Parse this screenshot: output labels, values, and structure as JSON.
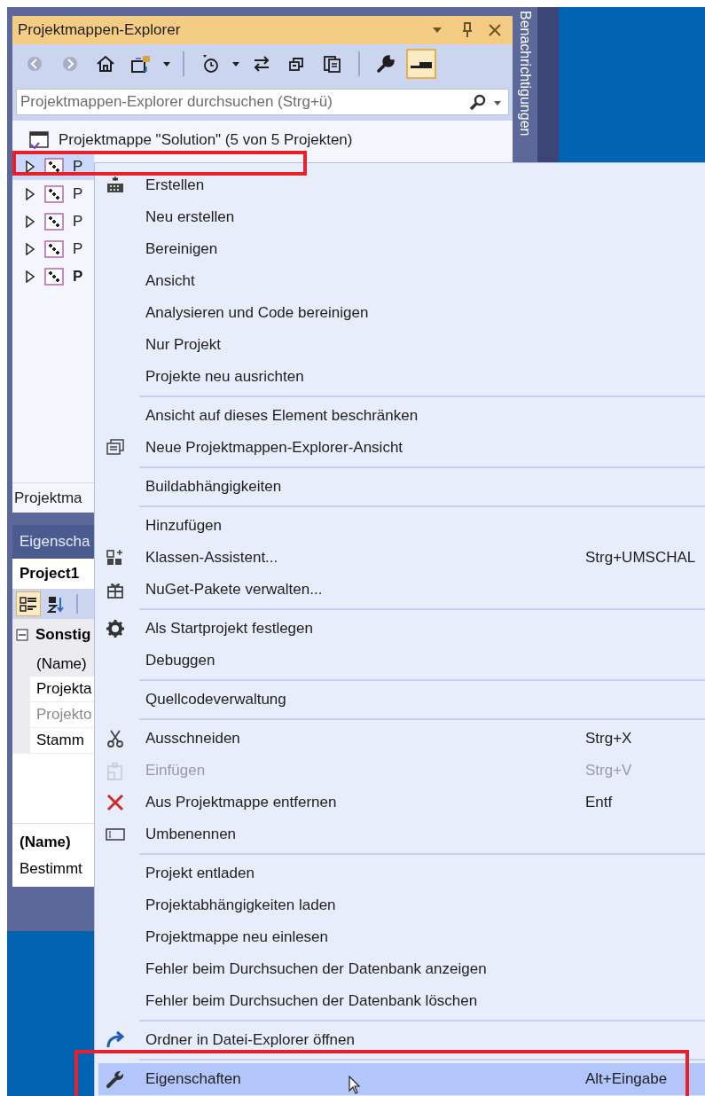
{
  "explorer": {
    "title": "Projektmappen-Explorer",
    "toolbar": [
      {
        "kind": "back",
        "disabled": true,
        "on": false
      },
      {
        "kind": "forward",
        "disabled": true,
        "on": false
      },
      {
        "kind": "home",
        "disabled": false,
        "on": false
      },
      {
        "kind": "switch-views",
        "disabled": false,
        "on": false
      },
      {
        "kind": "dropdown",
        "disabled": false,
        "on": false
      },
      {
        "kind": "separator"
      },
      {
        "kind": "pending",
        "disabled": false,
        "on": false
      },
      {
        "kind": "dropdown",
        "disabled": false,
        "on": false
      },
      {
        "kind": "sync",
        "disabled": false,
        "on": false
      },
      {
        "kind": "collapse",
        "disabled": false,
        "on": false
      },
      {
        "kind": "copy",
        "disabled": false,
        "on": false
      },
      {
        "kind": "separator"
      },
      {
        "kind": "properties",
        "disabled": false,
        "on": false
      },
      {
        "kind": "preview",
        "disabled": false,
        "on": true
      }
    ],
    "search": {
      "placeholder": "Projektmappen-Explorer durchsuchen (Strg+ü)"
    },
    "solution": "Projektmappe \"Solution\" (5 von 5 Projekten)",
    "projects": [
      {
        "label": "P",
        "selected": true,
        "startup": false
      },
      {
        "label": "P",
        "selected": false,
        "startup": false
      },
      {
        "label": "P",
        "selected": false,
        "startup": false
      },
      {
        "label": "P",
        "selected": false,
        "startup": false
      },
      {
        "label": "P",
        "selected": false,
        "startup": true
      }
    ],
    "bottom_tab": "Projektma"
  },
  "notifications_tab": "Benachrichtigungen",
  "properties": {
    "title": "Eigenscha",
    "object": "Project1",
    "toolbar": [
      {
        "kind": "categorized",
        "on": true
      },
      {
        "kind": "alphabetical",
        "on": false
      }
    ],
    "category": {
      "label": "Sonstig",
      "expanded": true
    },
    "rows": [
      {
        "label": "(Name)",
        "disabled": false,
        "selected": true
      },
      {
        "label": "Projekta",
        "disabled": false,
        "selected": false
      },
      {
        "label": "Projekto",
        "disabled": true,
        "selected": false
      },
      {
        "label": "Stamm",
        "disabled": false,
        "selected": false
      }
    ],
    "description": {
      "title": "(Name)",
      "text": "Bestimmt"
    }
  },
  "context_menu": {
    "items": [
      {
        "kind": "build",
        "label": "Erstellen",
        "disabled": false,
        "selected": false
      },
      {
        "kind": "plain",
        "label": "Neu erstellen",
        "disabled": false,
        "selected": false
      },
      {
        "kind": "plain",
        "label": "Bereinigen",
        "disabled": false,
        "selected": false
      },
      {
        "kind": "plain",
        "label": "Ansicht",
        "disabled": false,
        "selected": false
      },
      {
        "kind": "plain",
        "label": "Analysieren und Code bereinigen",
        "disabled": false,
        "selected": false
      },
      {
        "kind": "plain",
        "label": "Nur Projekt",
        "disabled": false,
        "selected": false
      },
      {
        "kind": "plain",
        "label": "Projekte neu ausrichten",
        "disabled": false,
        "selected": false
      },
      {
        "kind": "separator"
      },
      {
        "kind": "plain",
        "label": "Ansicht auf dieses Element beschränken",
        "disabled": false,
        "selected": false
      },
      {
        "kind": "window",
        "label": "Neue Projektmappen-Explorer-Ansicht",
        "disabled": false,
        "selected": false
      },
      {
        "kind": "separator"
      },
      {
        "kind": "plain",
        "label": "Buildabhängigkeiten",
        "disabled": false,
        "selected": false
      },
      {
        "kind": "separator"
      },
      {
        "kind": "plain",
        "label": "Hinzufügen",
        "disabled": false,
        "selected": false
      },
      {
        "kind": "wizard",
        "label": "Klassen-Assistent...",
        "shortcut": "Strg+UMSCHAL",
        "disabled": false,
        "selected": false
      },
      {
        "kind": "package",
        "label": "NuGet-Pakete verwalten...",
        "disabled": false,
        "selected": false
      },
      {
        "kind": "separator"
      },
      {
        "kind": "gear",
        "label": "Als Startprojekt festlegen",
        "disabled": false,
        "selected": false
      },
      {
        "kind": "plain",
        "label": "Debuggen",
        "disabled": false,
        "selected": false
      },
      {
        "kind": "separator"
      },
      {
        "kind": "plain",
        "label": "Quellcodeverwaltung",
        "disabled": false,
        "selected": false
      },
      {
        "kind": "separator"
      },
      {
        "kind": "cut",
        "label": "Ausschneiden",
        "shortcut": "Strg+X",
        "disabled": false,
        "selected": false
      },
      {
        "kind": "paste",
        "label": "Einfügen",
        "shortcut": "Strg+V",
        "disabled": true,
        "selected": false
      },
      {
        "kind": "remove",
        "label": "Aus Projektmappe entfernen",
        "shortcut": "Entf",
        "disabled": false,
        "selected": false
      },
      {
        "kind": "rename",
        "label": "Umbenennen",
        "disabled": false,
        "selected": false
      },
      {
        "kind": "separator"
      },
      {
        "kind": "plain",
        "label": "Projekt entladen",
        "disabled": false,
        "selected": false
      },
      {
        "kind": "plain",
        "label": "Projektabhängigkeiten laden",
        "disabled": false,
        "selected": false
      },
      {
        "kind": "plain",
        "label": "Projektmappe neu einlesen",
        "disabled": false,
        "selected": false
      },
      {
        "kind": "plain",
        "label": "Fehler beim Durchsuchen der Datenbank anzeigen",
        "disabled": false,
        "selected": false
      },
      {
        "kind": "plain",
        "label": "Fehler beim Durchsuchen der Datenbank löschen",
        "disabled": false,
        "selected": false
      },
      {
        "kind": "separator"
      },
      {
        "kind": "open-folder",
        "label": "Ordner in Datei-Explorer öffnen",
        "disabled": false,
        "selected": false
      },
      {
        "kind": "separator"
      },
      {
        "kind": "properties",
        "label": "Eigenschaften",
        "shortcut": "Alt+Eingabe",
        "disabled": false,
        "selected": true
      }
    ]
  }
}
